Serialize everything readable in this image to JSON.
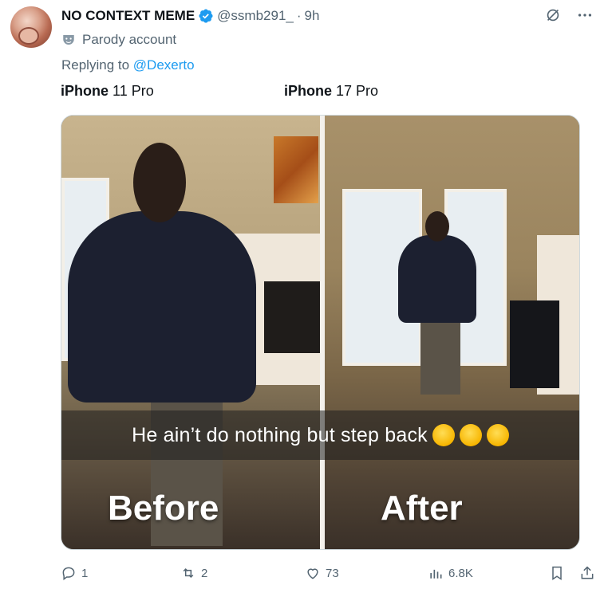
{
  "author": {
    "name": "NO CONTEXT MEME",
    "handle": "@ssmb291_",
    "separator": "·",
    "time": "9h",
    "parody_label": "Parody account"
  },
  "reply": {
    "prefix": "Replying to ",
    "mention": "@Dexerto"
  },
  "text_labels": {
    "left_bold": "iPhone",
    "left_rest": " 11 Pro",
    "right_bold": "iPhone",
    "right_rest": " 17 Pro"
  },
  "media": {
    "caption": "He ain’t do nothing but step back",
    "before_word": "Before",
    "after_word": "After",
    "emoji_name": "rolling-on-floor-laughing"
  },
  "actions": {
    "replies": "1",
    "reposts": "2",
    "likes": "73",
    "views": "6.8K"
  },
  "colors": {
    "accent": "#1d9bf0",
    "muted": "#536471",
    "text": "#0f1419"
  }
}
